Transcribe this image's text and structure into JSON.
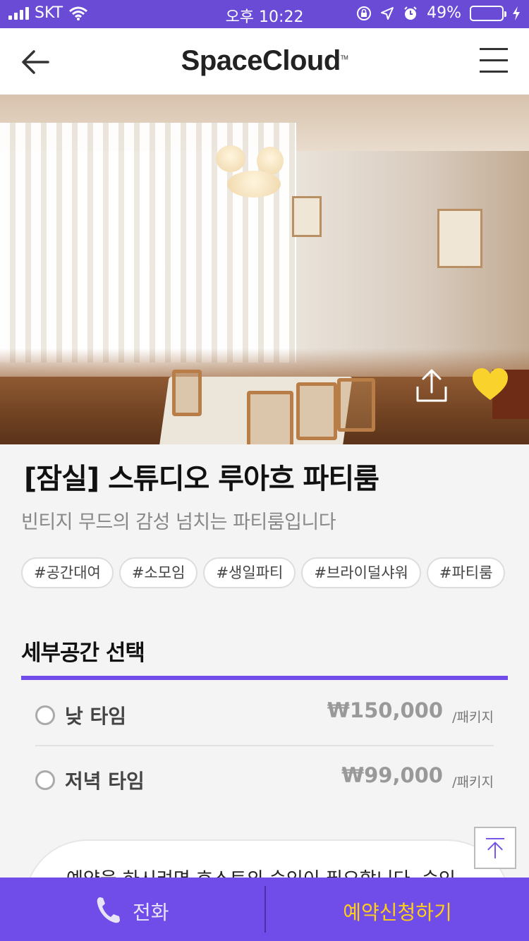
{
  "status_bar": {
    "carrier": "SKT",
    "time": "오후 10:22",
    "battery": "49%",
    "battery_level": 0.49
  },
  "header": {
    "logo": "SpaceCloud",
    "logo_mark": "TM"
  },
  "hero": {
    "icons": [
      "share-icon",
      "heart-icon"
    ],
    "heart_color": "#f9d22c"
  },
  "space": {
    "title": "[잠실] 스튜디오 루아흐 파티룸",
    "subtitle": "빈티지 무드의 감성 넘치는 파티룸입니다",
    "tags": [
      "#공간대여",
      "#소모임",
      "#생일파티",
      "#브라이덜샤워",
      "#파티룸"
    ]
  },
  "section": {
    "title": "세부공간 선택",
    "accent": "#704de8",
    "options": [
      {
        "name": "낮 타임",
        "price": "₩150,000",
        "unit": "/패키지"
      },
      {
        "name": "저녁 타임",
        "price": "₩99,000",
        "unit": "/패키지"
      }
    ]
  },
  "notice": {
    "text": "예약을 하시려면 호스트의 승인이 필요합니다. 승인"
  },
  "bottom_bar": {
    "call_label": "전화",
    "reserve_label": "예약신청하기",
    "reserve_color": "#ffd014"
  }
}
